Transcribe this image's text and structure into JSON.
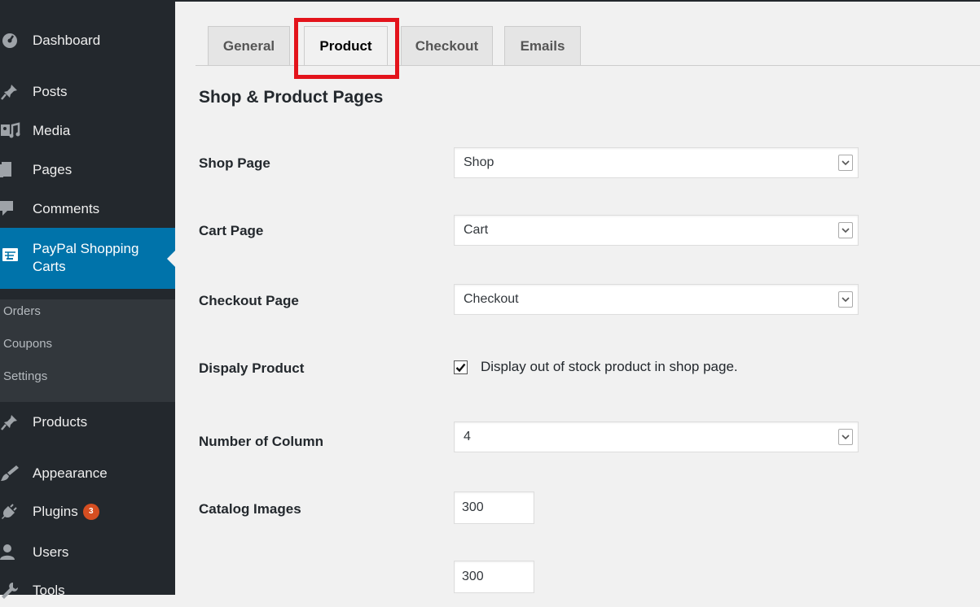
{
  "sidebar": {
    "items": {
      "dashboard": "Dashboard",
      "posts": "Posts",
      "media": "Media",
      "pages": "Pages",
      "comments": "Comments",
      "paypal_line1": "PayPal Shopping",
      "paypal_line2": "Carts",
      "products": "Products",
      "appearance": "Appearance",
      "plugins": "Plugins",
      "users": "Users",
      "tools": "Tools"
    },
    "plugins_badge": "3",
    "submenu": [
      "Orders",
      "Coupons",
      "Settings"
    ]
  },
  "tabs": [
    "General",
    "Product",
    "Checkout",
    "Emails"
  ],
  "active_tab": "Product",
  "section_title": "Shop & Product Pages",
  "form": {
    "shop_page": {
      "label": "Shop Page",
      "value": "Shop"
    },
    "cart_page": {
      "label": "Cart Page",
      "value": "Cart"
    },
    "checkout_page": {
      "label": "Checkout Page",
      "value": "Checkout"
    },
    "display_product": {
      "label": "Dispaly Product",
      "checkbox_text": "Display out of stock product in shop page.",
      "checked": true
    },
    "number_of_column": {
      "label": "Number of Column",
      "value": "4"
    },
    "catalog_images": {
      "label": "Catalog Images",
      "width": "300",
      "height": "300"
    }
  },
  "colors": {
    "sidebar_bg": "#23282d",
    "active_menu": "#0073aa",
    "highlight_box": "#e3131b",
    "badge": "#d54e21"
  }
}
